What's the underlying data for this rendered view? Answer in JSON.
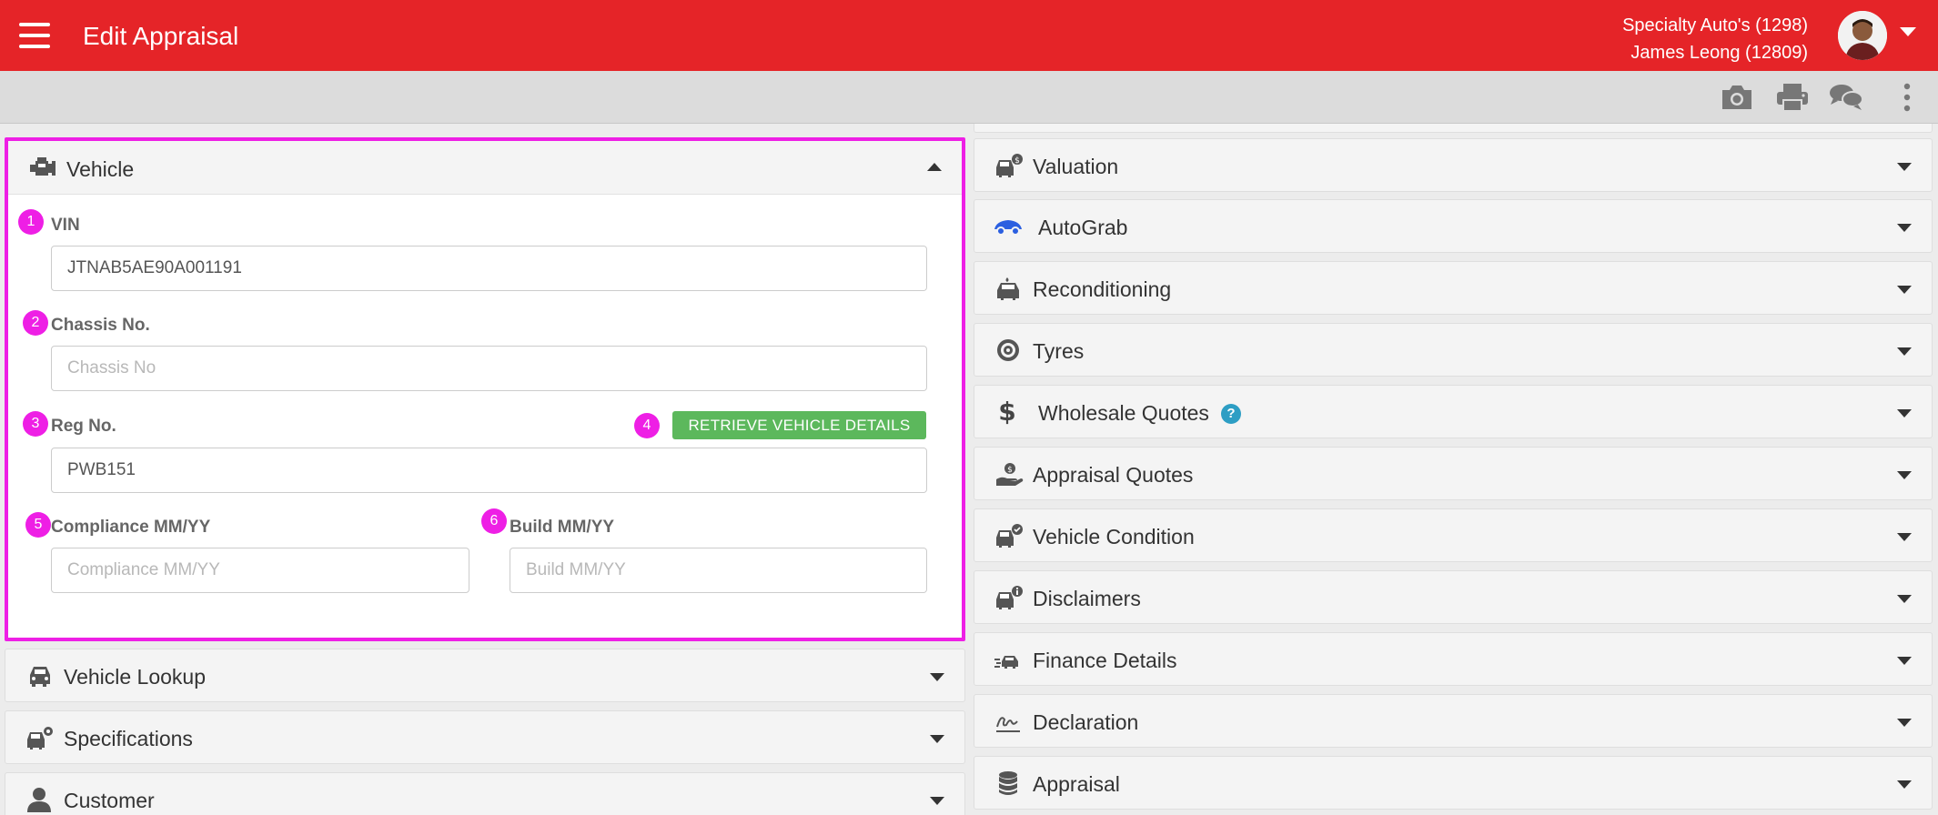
{
  "app": {
    "title": "Edit Appraisal",
    "dealer": "Specialty Auto's (1298)",
    "user": "James Leong (12809)"
  },
  "toolbar": {
    "icons": [
      "camera-icon",
      "print-icon",
      "chat-icon",
      "more-vertical-icon"
    ]
  },
  "vehicle": {
    "title": "Vehicle",
    "fields": {
      "vin": {
        "badge": "1",
        "label": "VIN",
        "value": "JTNAB5AE90A001191",
        "placeholder": ""
      },
      "chassis": {
        "badge": "2",
        "label": "Chassis No.",
        "value": "",
        "placeholder": "Chassis No"
      },
      "reg": {
        "badge": "3",
        "label": "Reg No.",
        "value": "PWB151",
        "placeholder": ""
      },
      "compliance": {
        "badge": "5",
        "label": "Compliance MM/YY",
        "value": "",
        "placeholder": "Compliance MM/YY"
      },
      "build": {
        "badge": "6",
        "label": "Build MM/YY",
        "value": "",
        "placeholder": "Build MM/YY"
      }
    },
    "retrieve": {
      "badge": "4",
      "label": "RETRIEVE VEHICLE DETAILS"
    }
  },
  "left_panels": [
    {
      "title": "Vehicle Lookup",
      "icon": "car-front-icon"
    },
    {
      "title": "Specifications",
      "icon": "car-settings-icon"
    },
    {
      "title": "Customer",
      "icon": "user-icon"
    }
  ],
  "right_panels": [
    {
      "title": "Valuation",
      "icon": "car-dollar-icon"
    },
    {
      "title": "AutoGrab",
      "icon": "autograb-icon"
    },
    {
      "title": "Reconditioning",
      "icon": "car-wash-icon"
    },
    {
      "title": "Tyres",
      "icon": "tyre-icon"
    },
    {
      "title": "Wholesale Quotes",
      "icon": "dollar-icon",
      "help": "?"
    },
    {
      "title": "Appraisal Quotes",
      "icon": "hand-dollar-icon"
    },
    {
      "title": "Vehicle Condition",
      "icon": "car-check-icon"
    },
    {
      "title": "Disclaimers",
      "icon": "car-info-icon"
    },
    {
      "title": "Finance Details",
      "icon": "car-speed-icon"
    },
    {
      "title": "Declaration",
      "icon": "signature-icon"
    },
    {
      "title": "Appraisal",
      "icon": "database-icon"
    }
  ],
  "colors": {
    "brand": "#e52428",
    "highlight": "#ee1fe5",
    "success": "#5cb85c",
    "help": "#2d9ec4"
  }
}
